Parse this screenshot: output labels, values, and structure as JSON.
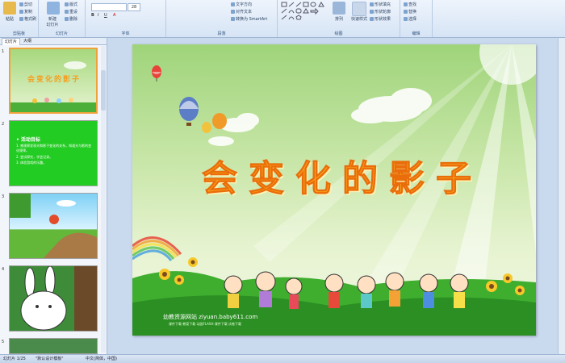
{
  "ribbon": {
    "clipboard": {
      "paste": "粘贴",
      "cut": "剪切",
      "copy": "复制",
      "format_painter": "格式刷",
      "label": "剪贴板"
    },
    "slides": {
      "new_slide": "新建\n幻灯片",
      "layout": "版式",
      "reset": "重设",
      "delete": "删除",
      "label": "幻灯片"
    },
    "font": {
      "size": "28",
      "label": "字体"
    },
    "paragraph": {
      "text_direction": "文字方向",
      "align_text": "对齐文本",
      "convert_smartart": "转换为 SmartArt",
      "label": "段落"
    },
    "drawing": {
      "arrange": "排列",
      "quick_styles": "快速样式",
      "shape_fill": "形状填充",
      "shape_outline": "形状轮廓",
      "shape_effects": "形状效果",
      "label": "绘图"
    },
    "editing": {
      "find": "查找",
      "replace": "替换",
      "select": "选择",
      "label": "编辑"
    }
  },
  "panel": {
    "tabs": [
      "幻灯片",
      "大纲"
    ],
    "slide_numbers": [
      "1",
      "2",
      "3",
      "4",
      "5"
    ],
    "slide1_title": "会变化的影子",
    "slide2": {
      "heading": "• 活动目标",
      "items": [
        "1. 感观察发现光和影子变化的关系，知道光与影的变化规律。",
        "2. 尝试探究，学会记录。",
        "3. 体验游戏的乐趣。"
      ]
    }
  },
  "slide": {
    "title": "会变化的影子",
    "footer_line1": "幼教资源网站  ziyuan.baby611.com",
    "footer_line2": "课件下载  教案下载  动画FLASH  课件下载  试卷下载"
  },
  "status": {
    "slide_position": "幻灯片 1/25",
    "theme": "\"默认设计模板\"",
    "language": "中文(简体，中国)"
  },
  "colors": {
    "title": "#f8a21c",
    "ribbon_bg": "#dbe6f4",
    "thumb2_bg": "#22cc22"
  }
}
